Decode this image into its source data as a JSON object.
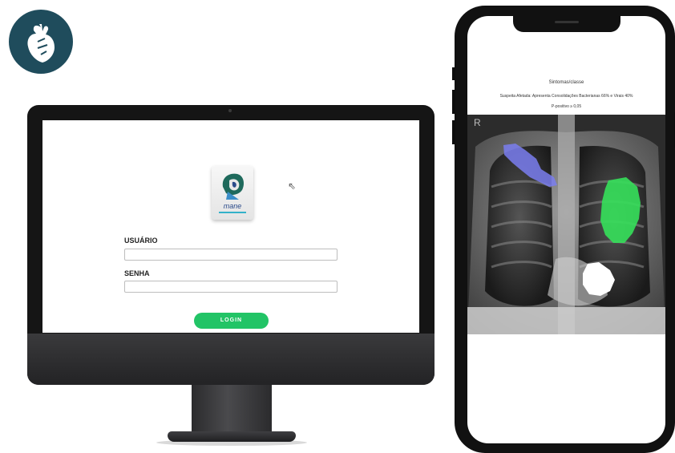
{
  "badge": {
    "icon": "heart-icon",
    "color": "#1f4c5c"
  },
  "desktop": {
    "logo_text": "mane",
    "username_label": "USUÁRIO",
    "username_value": "",
    "password_label": "SENHA",
    "password_value": "",
    "login_label": "LOGIN",
    "accent": "#22c466"
  },
  "mobile": {
    "title": "Sintomas/classe",
    "result": "Suspeita Afetada: Apresenta Consolidações Bacterianas 66% e Virais 40%",
    "p_value": "P-positivo ≥ 0,05",
    "xray_marker": "R",
    "overlay_colors": {
      "upper_right_lung": "#7a7ef0",
      "left_lung": "#35e05a",
      "lower_mass": "#ffffff"
    }
  }
}
